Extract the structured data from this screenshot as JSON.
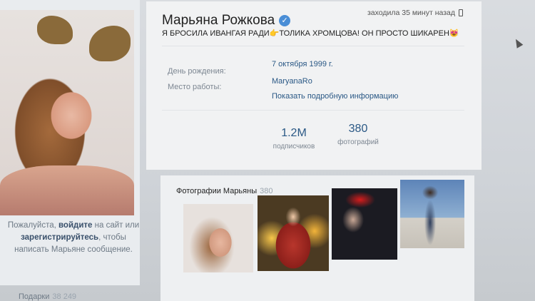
{
  "profile": {
    "name": "Марьяна Рожкова",
    "verified": true,
    "last_seen": "заходила 35 минут назад",
    "status": "Я БРОСИЛА ИВАНГАЯ РАДИ👉ТОЛИКА ХРОМЦОВА! ОН ПРОСТО ШИКАРЕН😻"
  },
  "info": {
    "birthday_label": "День рождения:",
    "birthday_value": "7 октября 1999 г.",
    "work_label": "Место работы:",
    "work_value": "MaryanaRo",
    "more_link": "Показать подробную информацию"
  },
  "counters": [
    {
      "value": "1.2M",
      "label": "подписчиков"
    },
    {
      "value": "380",
      "label": "фотографий"
    }
  ],
  "login_note": {
    "part1": "Пожалуйста, ",
    "link1": "войдите",
    "part2": " на сайт или ",
    "link2": "зарегистрируйтесь",
    "part3": ", чтобы написать Марьяне сообщение."
  },
  "gifts": {
    "label": "Подарки",
    "count": "38 249"
  },
  "photos": {
    "title": "Фотографии Марьяны",
    "count": "380"
  },
  "icons": [
    "verified-icon",
    "phone-icon",
    "cursor-icon"
  ]
}
